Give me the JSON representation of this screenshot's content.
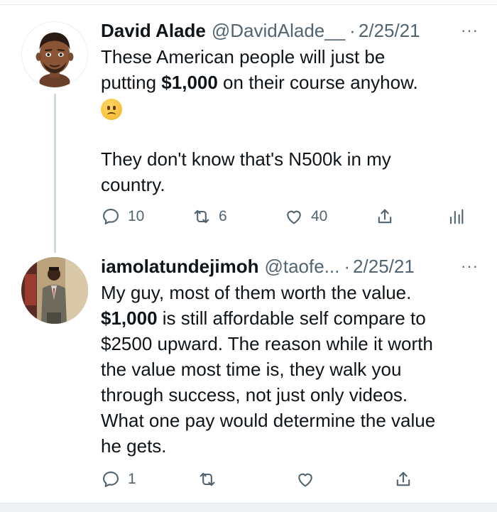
{
  "tweets": [
    {
      "display_name": "David Alade",
      "handle": "@DavidAlade__",
      "separator": "·",
      "date": "2/25/21",
      "more": "···",
      "text_lines": [
        [
          "These American people will just be"
        ],
        [
          "putting ",
          "$1,000",
          " on their course anyhow."
        ]
      ],
      "emoji": "frowning-face",
      "text_after": [
        "They don't know that's N500k in my",
        "country."
      ],
      "replies": "10",
      "retweets": "6",
      "likes": "40"
    },
    {
      "display_name": "iamolatundejimoh",
      "handle": "@taofe...",
      "separator": "·",
      "date": "2/25/21",
      "more": "···",
      "text_lines": [
        "My guy, most of them worth the value.",
        "$1,000",
        " is still affordable self compare to",
        "$2500 upward. The reason while it worth",
        "the value most time is, they walk you",
        "through success, not just only videos.",
        "What one pay would determine the value",
        "he gets."
      ],
      "replies": "1"
    }
  ],
  "colors": {
    "text": "#0f1419",
    "muted": "#536471",
    "thread_line": "#cfd9de"
  }
}
